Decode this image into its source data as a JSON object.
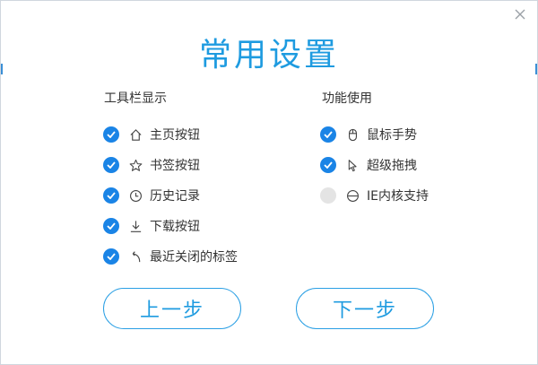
{
  "dialog": {
    "title": "常用设置",
    "close_symbol": "×"
  },
  "toolbar_section": {
    "heading": "工具栏显示",
    "items": [
      {
        "label": "主页按钮",
        "icon": "home-icon",
        "checked": true
      },
      {
        "label": "书签按钮",
        "icon": "star-icon",
        "checked": true
      },
      {
        "label": "历史记录",
        "icon": "clock-icon",
        "checked": true
      },
      {
        "label": "下载按钮",
        "icon": "download-icon",
        "checked": true
      },
      {
        "label": "最近关闭的标签",
        "icon": "undo-arrow-icon",
        "checked": true
      }
    ]
  },
  "feature_section": {
    "heading": "功能使用",
    "items": [
      {
        "label": "鼠标手势",
        "icon": "mouse-icon",
        "checked": true
      },
      {
        "label": "超级拖拽",
        "icon": "cursor-icon",
        "checked": true
      },
      {
        "label": "IE内核支持",
        "icon": "ie-icon",
        "checked": false
      }
    ]
  },
  "buttons": {
    "prev_label": "上一步",
    "next_label": "下一步"
  },
  "colors": {
    "accent": "#1e9be0",
    "check_on": "#1a84e6",
    "check_off": "#e4e4e4"
  }
}
